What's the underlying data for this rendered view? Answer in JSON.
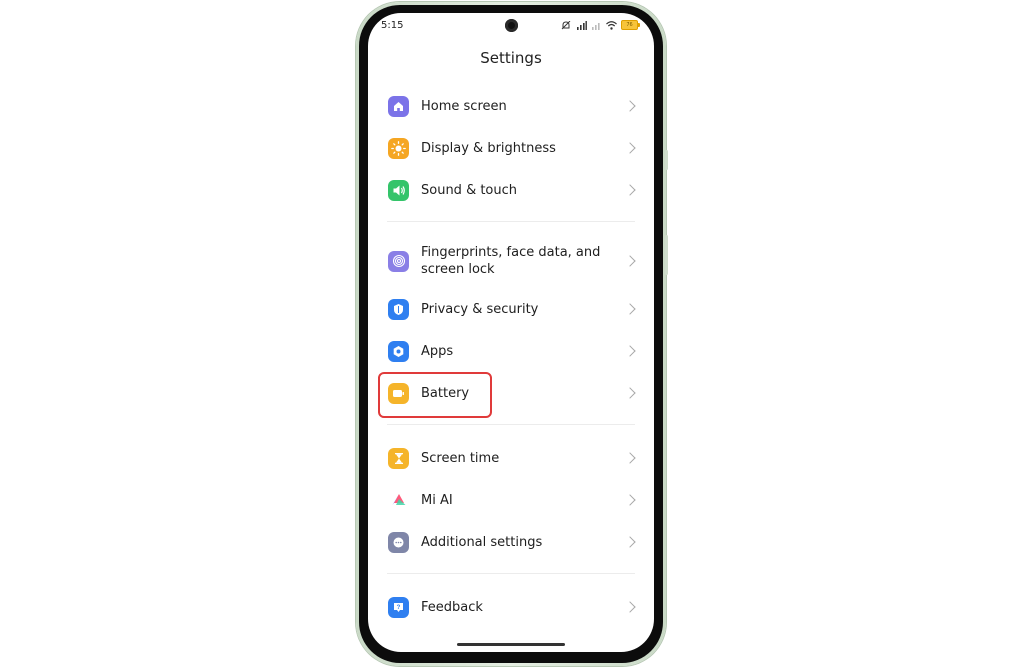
{
  "status_bar": {
    "time": "5:15",
    "icons": [
      "mute-icon",
      "hd-signal-icon",
      "signal-weak-icon",
      "wifi-icon",
      "battery-charging-icon"
    ],
    "battery_text": "76"
  },
  "header": {
    "title": "Settings"
  },
  "groups": [
    {
      "items": [
        {
          "label": "Home screen",
          "icon": "home-icon",
          "color": "#7b73e8"
        },
        {
          "label": "Display & brightness",
          "icon": "sun-icon",
          "color": "#f5a623"
        },
        {
          "label": "Sound & touch",
          "icon": "speaker-icon",
          "color": "#34c46a"
        }
      ]
    },
    {
      "items": [
        {
          "label": "Fingerprints, face data, and screen lock",
          "icon": "fingerprint-icon",
          "color": "#8a7fe6"
        },
        {
          "label": "Privacy & security",
          "icon": "shield-icon",
          "color": "#2f7ff0"
        },
        {
          "label": "Apps",
          "icon": "apps-gear-icon",
          "color": "#2f7ff0"
        },
        {
          "label": "Battery",
          "icon": "battery-icon",
          "color": "#f5b42a",
          "highlighted": true
        }
      ]
    },
    {
      "items": [
        {
          "label": "Screen time",
          "icon": "hourglass-icon",
          "color": "#f5b42a"
        },
        {
          "label": "Mi AI",
          "icon": "mi-ai-icon",
          "color": "#ffffff"
        },
        {
          "label": "Additional settings",
          "icon": "more-icon",
          "color": "#7f86a8"
        }
      ]
    },
    {
      "items": [
        {
          "label": "Feedback",
          "icon": "feedback-icon",
          "color": "#2f7ff0"
        }
      ]
    }
  ],
  "annotation": {
    "highlight_color": "#e03a3a",
    "target": "Battery"
  }
}
